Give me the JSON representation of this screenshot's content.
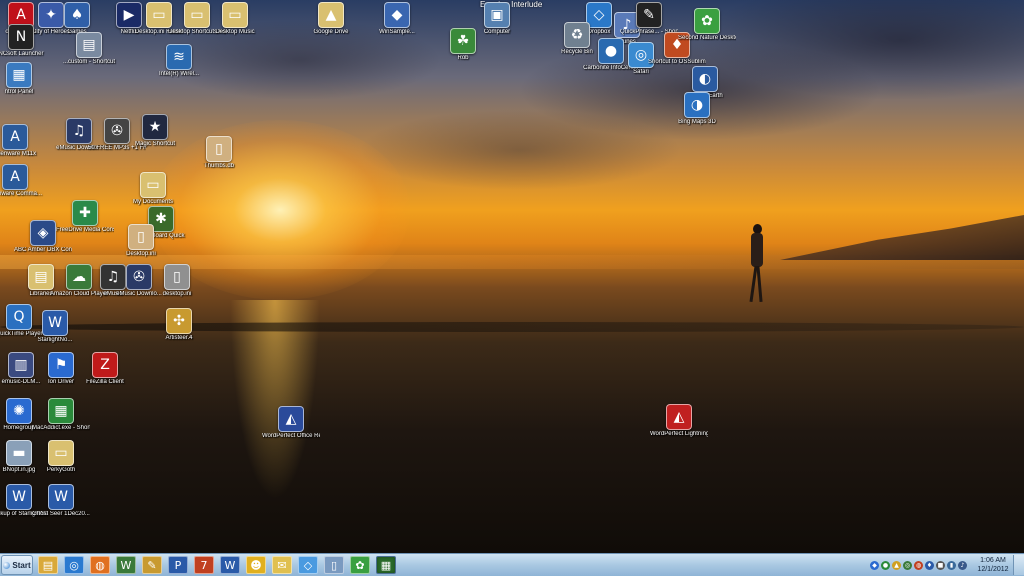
{
  "desktop": {
    "title": "Evening Interlude",
    "icons": [
      {
        "label": "obe Reader",
        "symbol": "A",
        "color": "#c0101a"
      },
      {
        "label": "City of Heroes",
        "symbol": "✦",
        "color": "#3a5aa8"
      },
      {
        "label": "Games",
        "symbol": "♠",
        "color": "#2f5fa8"
      },
      {
        "label": "Netflix",
        "symbol": "▶",
        "color": "#1a2a66"
      },
      {
        "label": "Desktop.ini Folder",
        "symbol": "▭",
        "color": "#d9c070"
      },
      {
        "label": "Desktop Shortcuts Folder",
        "symbol": "▭",
        "color": "#d9c070"
      },
      {
        "label": "Desktop Music",
        "symbol": "▭",
        "color": "#d9c070"
      },
      {
        "label": "Google Drive",
        "symbol": "▲",
        "color": "#d9c070"
      },
      {
        "label": "WinSample...",
        "symbol": "◆",
        "color": "#3a66b0"
      },
      {
        "label": "Computer",
        "symbol": "▣",
        "color": "#5580b0"
      },
      {
        "label": "Rob",
        "symbol": "☘",
        "color": "#3a8a3a"
      },
      {
        "label": "Dropbox",
        "symbol": "◇",
        "color": "#2a78c8"
      },
      {
        "label": "Recycle Bin",
        "symbol": "♻",
        "color": "#708090"
      },
      {
        "label": "iTunes",
        "symbol": "♪",
        "color": "#5a7ab8"
      },
      {
        "label": "Carbonite InfoCenter",
        "symbol": "●",
        "color": "#2a6ab0"
      },
      {
        "label": "QuickPhrase... - Shortcut",
        "symbol": "✎",
        "color": "#222222"
      },
      {
        "label": "Safari",
        "symbol": "◎",
        "color": "#3a8ad0"
      },
      {
        "label": "Shortcut to OSSubliminal",
        "symbol": "♦",
        "color": "#c04a20"
      },
      {
        "label": "Second Nature Desktop",
        "symbol": "✿",
        "color": "#3aa040"
      },
      {
        "label": "Google Earth",
        "symbol": "◐",
        "color": "#2a5aa0"
      },
      {
        "label": "Bing Maps 3D",
        "symbol": "◑",
        "color": "#2a70c0"
      },
      {
        "label": "NCsoft Launcher",
        "symbol": "N",
        "color": "#222222"
      },
      {
        "label": "...custom - Shortcut",
        "symbol": "▤",
        "color": "#7a8aa0"
      },
      {
        "label": "Intel(R) Wirel...",
        "symbol": "≋",
        "color": "#2a6ab0"
      },
      {
        "label": "ntrol Panel",
        "symbol": "▦",
        "color": "#3a7ac0"
      },
      {
        "label": "Alienware M11x",
        "symbol": "A",
        "color": "#2a5a9a"
      },
      {
        "label": "eMusic Downlo...",
        "symbol": "♫",
        "color": "#2a3a66"
      },
      {
        "label": "50 FREE MP3s +1 Free Au...",
        "symbol": "✇",
        "color": "#444444"
      },
      {
        "label": "Magic Shortcut",
        "symbol": "★",
        "color": "#202840"
      },
      {
        "label": "Thumbs.db",
        "symbol": "▯",
        "color": "#d0b080"
      },
      {
        "label": "Alienware Comma...",
        "symbol": "A",
        "color": "#2a5a9a"
      },
      {
        "label": "My Documents",
        "symbol": "▭",
        "color": "#d9c070"
      },
      {
        "label": "FreeDrive Media Console",
        "symbol": "✚",
        "color": "#2a8a4a"
      },
      {
        "label": "StoryBoard Quick",
        "symbol": "✱",
        "color": "#3a6a2a"
      },
      {
        "label": "ABC Amber DBX Converter",
        "symbol": "◈",
        "color": "#2a4a88"
      },
      {
        "label": "Desktop.ini",
        "symbol": "▯",
        "color": "#d0b080"
      },
      {
        "label": "Libraries",
        "symbol": "▤",
        "color": "#d9c070"
      },
      {
        "label": "Amazon Cloud Player",
        "symbol": "☁",
        "color": "#3a7a3a"
      },
      {
        "label": "eMusic",
        "symbol": "♫",
        "color": "#333333"
      },
      {
        "label": "eMusic Downlo...",
        "symbol": "✇",
        "color": "#2a3a66"
      },
      {
        "label": "desktop.ini",
        "symbol": "▯",
        "color": "#909090"
      },
      {
        "label": "QuickTime Player",
        "symbol": "Q",
        "color": "#2a70c0"
      },
      {
        "label": "StarlightNo...",
        "symbol": "W",
        "color": "#2a5aa8"
      },
      {
        "label": "Artisteer.4",
        "symbol": "✣",
        "color": "#c89a30"
      },
      {
        "label": "emusic-DLM...",
        "symbol": "▥",
        "color": "#3a4a80"
      },
      {
        "label": "Ion Driver",
        "symbol": "⚑",
        "color": "#2a6ad0"
      },
      {
        "label": "FileZilla Client",
        "symbol": "Z",
        "color": "#c01a1a"
      },
      {
        "label": "Homegroup",
        "symbol": "✺",
        "color": "#2a6ad0"
      },
      {
        "label": "MacAddict.exe - Shortcut",
        "symbol": "▦",
        "color": "#2a8a3a"
      },
      {
        "label": "WordPerfect Office Ready",
        "symbol": "◭",
        "color": "#2a4a9a"
      },
      {
        "label": "WordPerfect Lightning",
        "symbol": "◭",
        "color": "#c02020"
      },
      {
        "label": "BNopt.in.jpg",
        "symbol": "▬",
        "color": "#8aa0b8"
      },
      {
        "label": "PerkyGoth",
        "symbol": "▭",
        "color": "#d9c070"
      },
      {
        "label": "Backup of StarlightNo...",
        "symbol": "W",
        "color": "#2a5aa8"
      },
      {
        "label": "Ghost Seer 1Dec20...",
        "symbol": "W",
        "color": "#2a5aa8"
      }
    ]
  },
  "taskbar": {
    "start_label": "Start",
    "items": [
      {
        "symbol": "▤",
        "color": "#d9a93a"
      },
      {
        "symbol": "◎",
        "color": "#2a7ad0"
      },
      {
        "symbol": "◍",
        "color": "#e07020"
      },
      {
        "symbol": "W",
        "color": "#3a7a3a"
      },
      {
        "symbol": "✎",
        "color": "#c89a30"
      },
      {
        "symbol": "P",
        "color": "#2a5aa8"
      },
      {
        "symbol": "7",
        "color": "#c04020"
      },
      {
        "symbol": "W",
        "color": "#2a5aa8"
      },
      {
        "symbol": "☻",
        "color": "#e0b020"
      },
      {
        "symbol": "✉",
        "color": "#e0c050"
      },
      {
        "symbol": "◇",
        "color": "#4a9ae0"
      },
      {
        "symbol": "▯",
        "color": "#7a9ac0"
      },
      {
        "symbol": "✿",
        "color": "#3aa040"
      },
      {
        "symbol": "▦",
        "color": "#2a6a2a"
      }
    ],
    "tray_icons": [
      {
        "symbol": "◆",
        "color": "#2a6ad0"
      },
      {
        "symbol": "●",
        "color": "#2a8a3a"
      },
      {
        "symbol": "▲",
        "color": "#d0a020"
      },
      {
        "symbol": "◎",
        "color": "#3a7a3a"
      },
      {
        "symbol": "◍",
        "color": "#c04020"
      },
      {
        "symbol": "♦",
        "color": "#2a5aa8"
      },
      {
        "symbol": "■",
        "color": "#555555"
      },
      {
        "symbol": "▮",
        "color": "#3a6a9a"
      },
      {
        "symbol": "♪",
        "color": "#3a5a8a"
      }
    ],
    "clock_time": "1:06 AM",
    "clock_date": "12/1/2012"
  }
}
